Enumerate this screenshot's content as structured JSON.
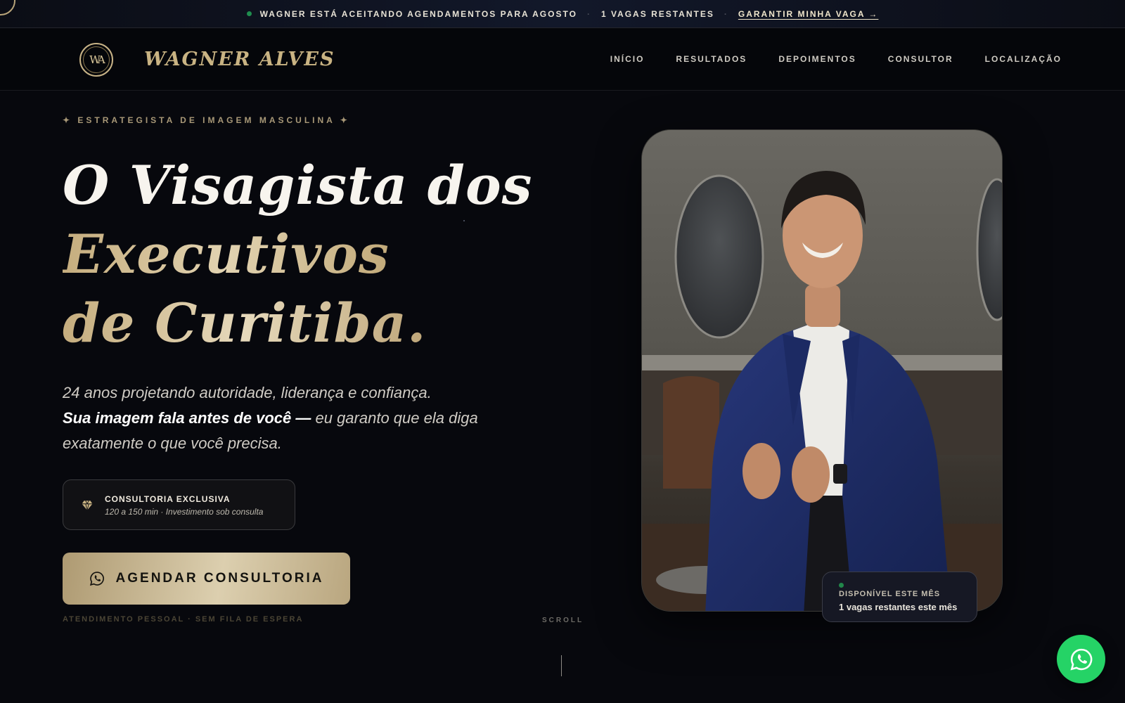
{
  "announcement": {
    "message": "WAGNER ESTÁ ACEITANDO AGENDAMENTOS PARA AGOSTO",
    "slots": "1 VAGAS RESTANTES",
    "cta": "GARANTIR MINHA VAGA →",
    "separator": "·"
  },
  "brand": {
    "monogram": "WA",
    "name": "WAGNER ALVES"
  },
  "nav": {
    "items": [
      "INÍCIO",
      "RESULTADOS",
      "DEPOIMENTOS",
      "CONSULTOR",
      "LOCALIZAÇÃO"
    ]
  },
  "hero": {
    "eyebrow": "✦ ESTRATEGISTA DE IMAGEM MASCULINA ✦",
    "title_line1": "O Visagista dos",
    "title_line2": "Executivos",
    "title_line3": "de Curitiba.",
    "lead_part1": "24 anos projetando autoridade, liderança e confiança.",
    "lead_bold": "Sua imagem fala antes de você —",
    "lead_part2": " eu garanto que ela diga exatamente o que você precisa.",
    "card_title": "CONSULTORIA EXCLUSIVA",
    "card_sub": "120 a 150 min · Investimento sob consulta",
    "cta_label": "AGENDAR CONSULTORIA",
    "cta_note": "ATENDIMENTO PESSOAL · SEM FILA DE ESPERA",
    "scroll_label": "SCROLL"
  },
  "availability": {
    "title": "DISPONÍVEL ESTE MÊS",
    "detail": "1 vagas restantes este mês"
  },
  "icons": {
    "status_dot": "green-dot-icon",
    "diamond": "diamond-icon",
    "whatsapp": "whatsapp-icon"
  },
  "colors": {
    "gold": "#c9b383",
    "background": "#07080d",
    "whatsapp_green": "#25d366",
    "status_green": "#1f8d4e"
  }
}
